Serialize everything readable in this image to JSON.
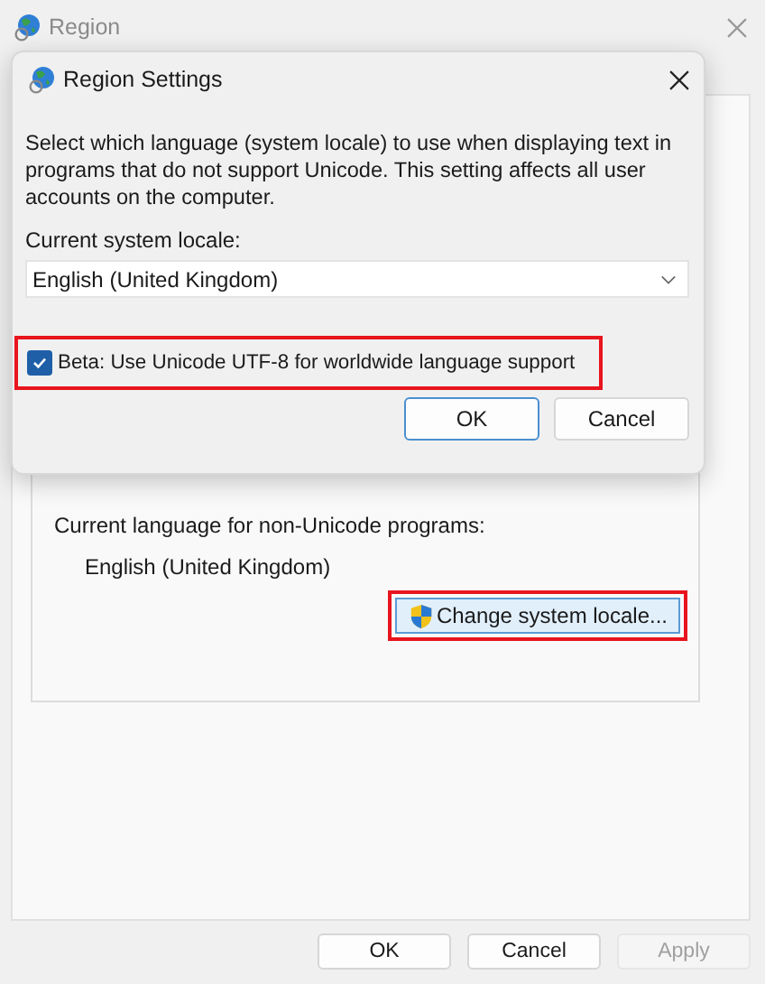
{
  "window": {
    "title": "Region",
    "active": false
  },
  "panel": {
    "group": {
      "label": "Current language for non-Unicode programs:",
      "value": "English (United Kingdom)",
      "button": {
        "label": "Change system locale...",
        "highlighted": true
      }
    }
  },
  "buttons": [
    {
      "label": "OK",
      "disabled": false
    },
    {
      "label": "Cancel",
      "disabled": false
    },
    {
      "label": "Apply",
      "disabled": true
    }
  ],
  "dialog": {
    "title": "Region Settings",
    "description": "Select which language (system locale) to use when displaying text in programs that do not support Unicode. This setting affects all user accounts on the computer.",
    "locale_label": "Current system locale:",
    "locale_value": "English (United Kingdom)",
    "checkbox": {
      "label": "Beta: Use Unicode UTF-8 for worldwide language support",
      "checked": true,
      "highlighted": true
    },
    "buttons": [
      {
        "label": "OK",
        "default": true
      },
      {
        "label": "Cancel",
        "default": false
      }
    ]
  }
}
